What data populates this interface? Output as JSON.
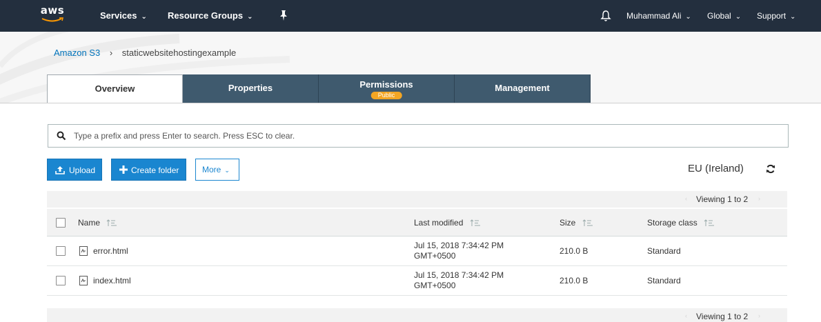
{
  "nav": {
    "logo_text": "aws",
    "services": "Services",
    "resource_groups": "Resource Groups",
    "user": "Muhammad Ali",
    "region_menu": "Global",
    "support": "Support"
  },
  "breadcrumb": {
    "root": "Amazon S3",
    "separator": "›",
    "bucket": "staticwebsitehostingexample"
  },
  "tabs": [
    {
      "label": "Overview",
      "active": true
    },
    {
      "label": "Properties"
    },
    {
      "label": "Permissions",
      "badge": "Public"
    },
    {
      "label": "Management"
    }
  ],
  "search": {
    "placeholder": "Type a prefix and press Enter to search. Press ESC to clear."
  },
  "actions": {
    "upload": "Upload",
    "create_folder": "Create folder",
    "more": "More"
  },
  "region": "EU (Ireland)",
  "table": {
    "viewing_top": "Viewing 1 to 2",
    "viewing_bottom": "Viewing 1 to 2",
    "columns": {
      "name": "Name",
      "last_modified": "Last modified",
      "size": "Size",
      "storage_class": "Storage class"
    },
    "rows": [
      {
        "name": "error.html",
        "modified_line1": "Jul 15, 2018 7:34:42 PM",
        "modified_line2": "GMT+0500",
        "size": "210.0 B",
        "storage_class": "Standard"
      },
      {
        "name": "index.html",
        "modified_line1": "Jul 15, 2018 7:34:42 PM",
        "modified_line2": "GMT+0500",
        "size": "210.0 B",
        "storage_class": "Standard"
      }
    ]
  },
  "colors": {
    "nav_bg": "#232f3e",
    "tab_bg": "#3f5a6e",
    "primary": "#1a86d0",
    "link": "#0073bb",
    "badge": "#f4a623"
  },
  "icons": [
    "aws-logo",
    "chevron-down-icon",
    "pin-icon",
    "bell-icon",
    "search-icon",
    "upload-icon",
    "plus-icon",
    "refresh-icon",
    "sort-icon",
    "file-icon"
  ]
}
